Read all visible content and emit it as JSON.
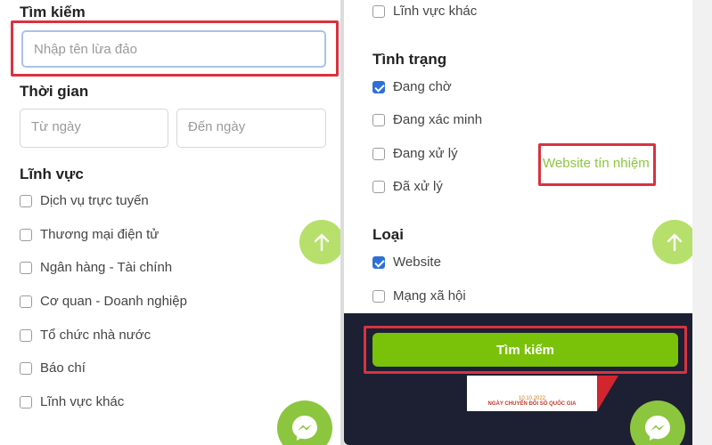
{
  "left": {
    "search_heading": "Tìm kiếm",
    "search_placeholder": "Nhập tên lừa đảo",
    "time_heading": "Thời gian",
    "from_date_placeholder": "Từ ngày",
    "to_date_placeholder": "Đến ngày",
    "field_heading": "Lĩnh vực",
    "fields": [
      {
        "label": "Dịch vụ trực tuyến",
        "checked": false
      },
      {
        "label": "Thương mại điện tử",
        "checked": false
      },
      {
        "label": "Ngân hàng - Tài chính",
        "checked": false
      },
      {
        "label": "Cơ quan - Doanh nghiệp",
        "checked": false
      },
      {
        "label": "Tổ chức nhà nước",
        "checked": false
      },
      {
        "label": "Báo chí",
        "checked": false
      },
      {
        "label": "Lĩnh vực khác",
        "checked": false
      }
    ]
  },
  "right": {
    "field_other": "Lĩnh vực khác",
    "status_heading": "Tình trạng",
    "statuses": [
      {
        "label": "Đang chờ",
        "checked": true
      },
      {
        "label": "Đang xác minh",
        "checked": false
      },
      {
        "label": "Đang xử lý",
        "checked": false
      },
      {
        "label": "Đã xử lý",
        "checked": false
      }
    ],
    "trust_link": "Website tín nhiệm",
    "type_heading": "Loại",
    "types": [
      {
        "label": "Website",
        "checked": true
      },
      {
        "label": "Mạng xã hội",
        "checked": false
      }
    ],
    "search_button": "Tìm kiếm",
    "banner_date": "10.10.2022",
    "banner_text": "NGÀY CHUYỂN ĐỔI SỐ QUỐC GIA"
  },
  "icons": {
    "scroll_top": "arrow-up-icon",
    "messenger": "messenger-icon"
  },
  "colors": {
    "accent_green": "#7ac10a",
    "highlight_red": "#d9323f",
    "checkbox_blue": "#2f6fd8"
  }
}
